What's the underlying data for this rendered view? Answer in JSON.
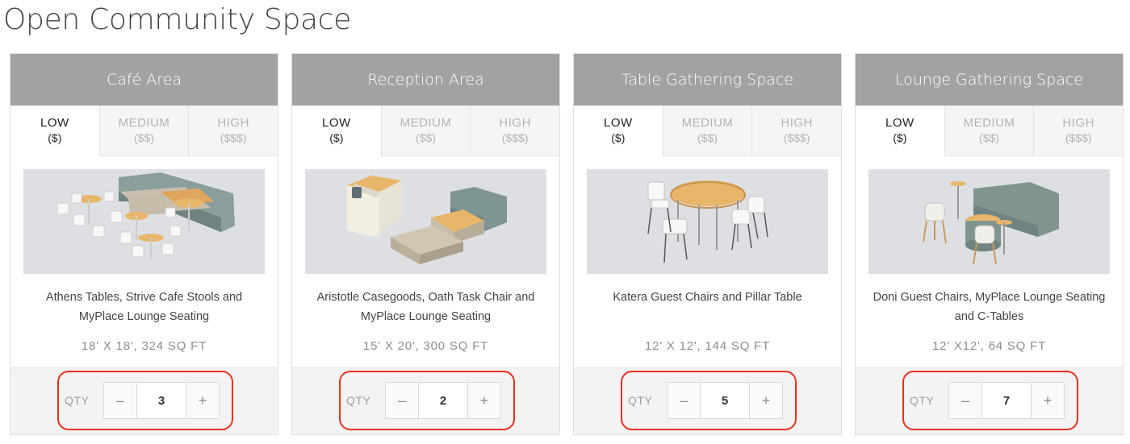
{
  "page_title": "Open Community Space",
  "tiers": [
    {
      "label": "LOW",
      "price": "($)"
    },
    {
      "label": "MEDIUM",
      "price": "($$)"
    },
    {
      "label": "HIGH",
      "price": "($$$)"
    }
  ],
  "qty_label": "QTY",
  "minus_label": "–",
  "plus_label": "+",
  "cards": [
    {
      "title": "Café Area",
      "active_tier": "LOW",
      "description": "Athens Tables, Strive Cafe Stools and MyPlace Lounge Seating",
      "dimensions": "18' X 18', 324 SQ FT",
      "quantity": "3"
    },
    {
      "title": "Reception Area",
      "active_tier": "LOW",
      "description": "Aristotle Casegoods, Oath Task Chair and MyPlace Lounge Seating",
      "dimensions": "15' X 20', 300 SQ FT",
      "quantity": "2"
    },
    {
      "title": "Table Gathering Space",
      "active_tier": "LOW",
      "description": "Katera Guest Chairs and Pillar Table",
      "dimensions": "12' X 12', 144 SQ FT",
      "quantity": "5"
    },
    {
      "title": "Lounge Gathering Space",
      "active_tier": "LOW",
      "description": "Doni Guest Chairs, MyPlace Lounge Seating and C-Tables",
      "dimensions": "12' X12', 64 SQ FT",
      "quantity": "7"
    }
  ],
  "colors": {
    "header_bg": "#a2a2a2",
    "highlight_border": "#e8321e",
    "image_bg": "#dedfe3"
  }
}
